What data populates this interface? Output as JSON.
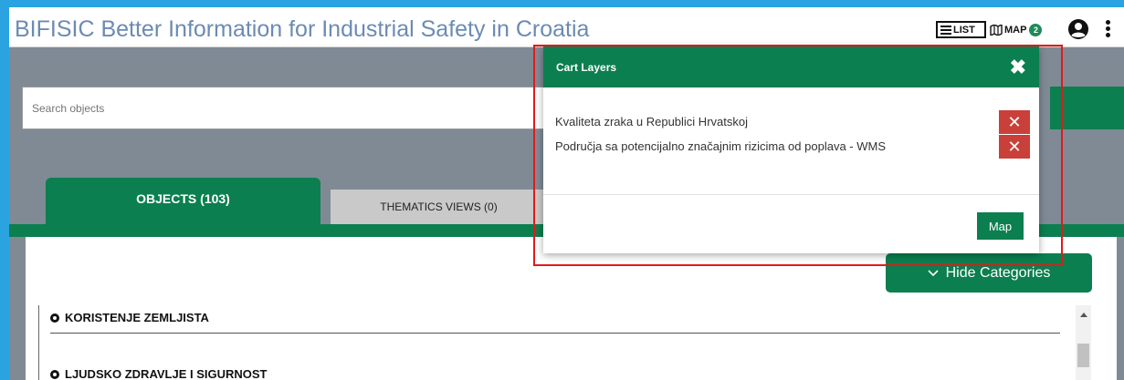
{
  "header": {
    "title": "BIFISIC Better Information for Industrial Safety in Croatia",
    "list_label": "LIST",
    "map_label": "MAP",
    "map_count": "2"
  },
  "search": {
    "placeholder": "Search objects"
  },
  "tabs": [
    {
      "label": "OBJECTS (103)",
      "active": true
    },
    {
      "label": "THEMATICS VIEWS (0)",
      "active": false
    }
  ],
  "hide_categories_label": "Hide Categories",
  "categories": [
    {
      "label": "KORISTENJE ZEMLJISTA"
    },
    {
      "label": "LJUDSKO ZDRAVLJE I SIGURNOST"
    }
  ],
  "modal": {
    "title": "Cart Layers",
    "layers": [
      {
        "name": "Kvaliteta zraka u Republici Hrvatskoj"
      },
      {
        "name": "Područja sa potencijalno značajnim rizicima od poplava - WMS"
      }
    ],
    "map_button": "Map"
  },
  "colors": {
    "brand_green": "#0b7f4f",
    "delete_red": "#c9403a",
    "highlight_red": "#e31919",
    "title_blue": "#6b8bb3"
  }
}
